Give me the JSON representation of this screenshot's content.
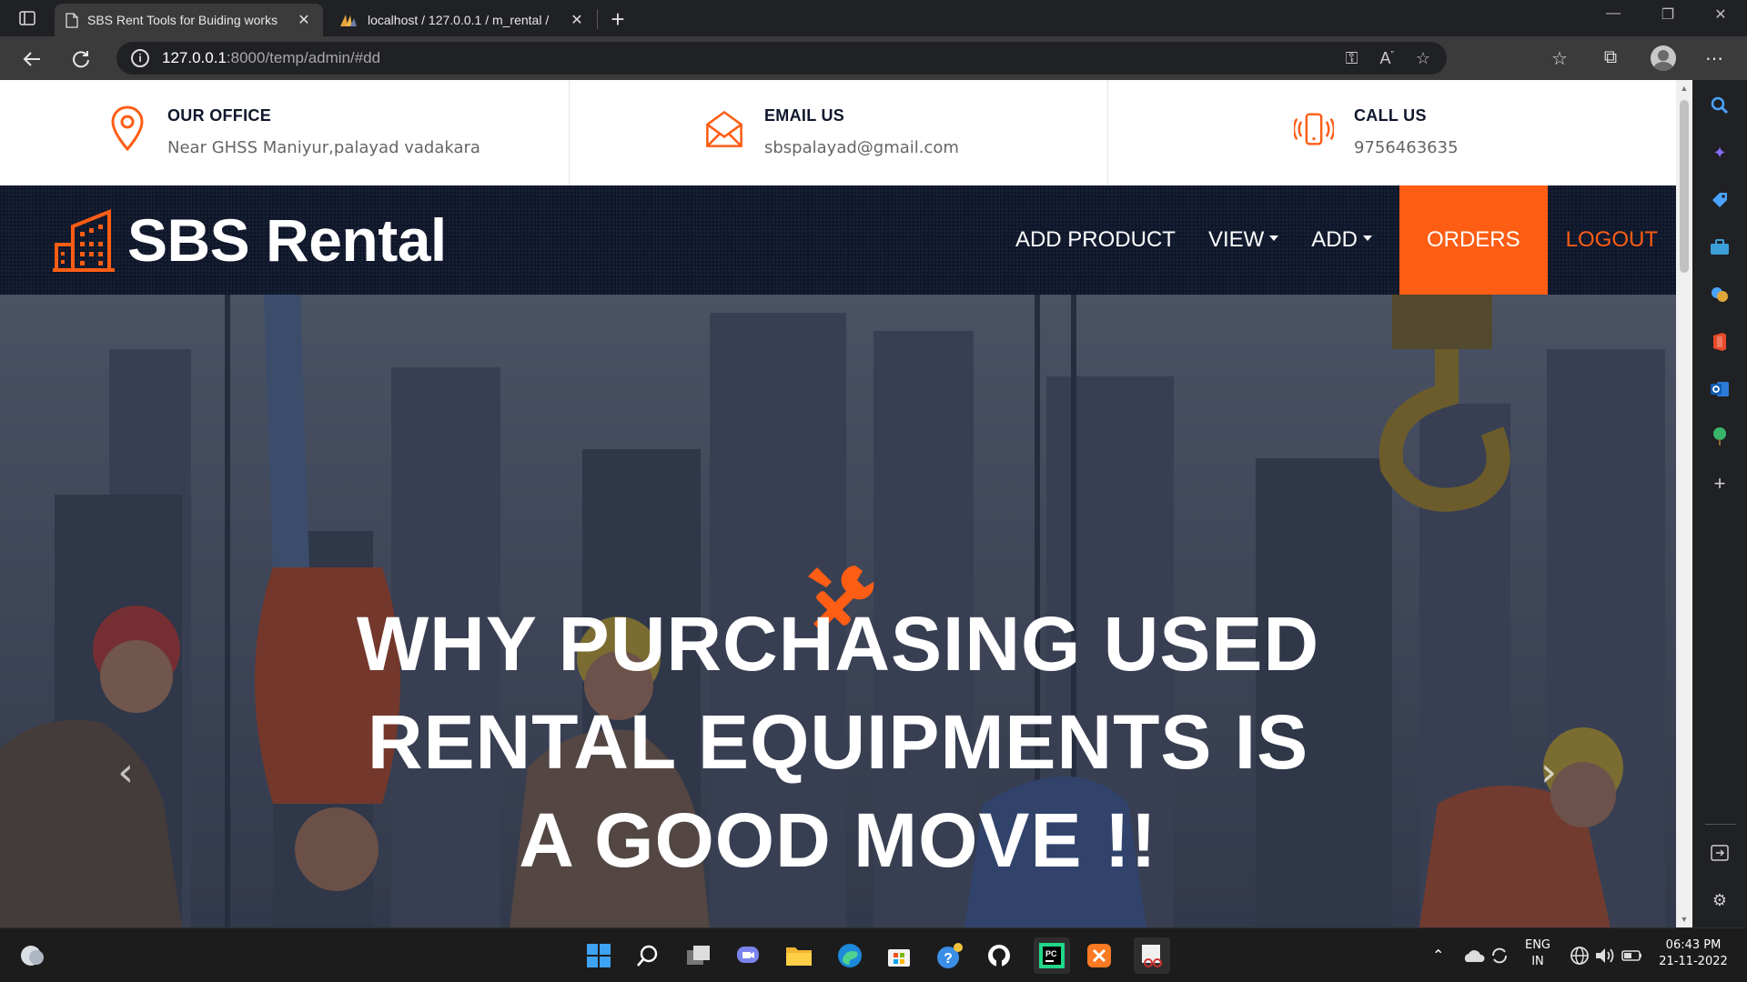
{
  "browser": {
    "tabs": [
      {
        "title": "SBS Rent Tools for Buiding works",
        "active": true
      },
      {
        "title": "localhost / 127.0.0.1 / m_rental /",
        "active": false
      }
    ],
    "url_host": "127.0.0.1",
    "url_path": ":8000/temp/admin/#dd"
  },
  "contact": {
    "office": {
      "title": "OUR OFFICE",
      "value": "Near GHSS Maniyur,palayad vadakara"
    },
    "email": {
      "title": "EMAIL US",
      "value": "sbspalayad@gmail.com"
    },
    "call": {
      "title": "CALL US",
      "value": "9756463635"
    }
  },
  "brand": {
    "name": "SBS Rental"
  },
  "menu": {
    "add_product": "ADD PRODUCT",
    "view": "VIEW",
    "add": "ADD",
    "orders": "ORDERS",
    "logout": "LOGOUT"
  },
  "hero": {
    "heading": "WHY PURCHASING USED RENTAL EQUIPMENTS IS A GOOD MOVE !!"
  },
  "carousel": {
    "prev": "‹",
    "next": "›"
  },
  "taskbar": {
    "lang_primary": "ENG",
    "lang_secondary": "IN",
    "time": "06:43 PM",
    "date": "21-11-2022"
  },
  "colors": {
    "accent": "#fe5d14",
    "navy": "#0f172b"
  },
  "icons": {
    "office": "map-pin-icon",
    "email": "envelope-icon",
    "call": "phone-vibrate-icon",
    "brand": "building-icon",
    "hero": "tools-icon"
  }
}
